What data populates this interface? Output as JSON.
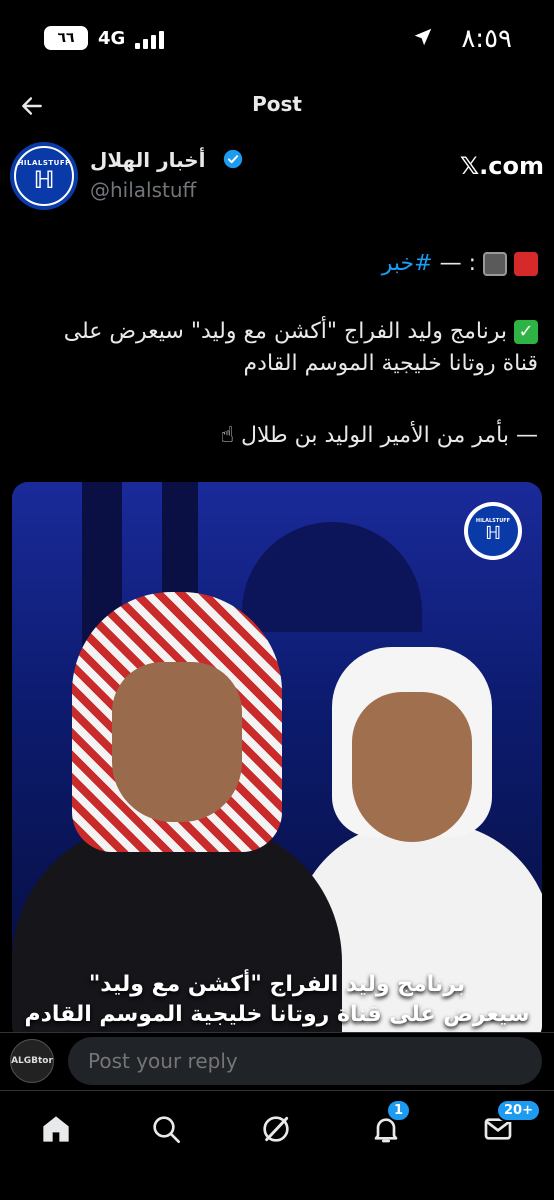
{
  "status_bar": {
    "time": "٨:٥٩",
    "battery": "٦٦",
    "network": "4G"
  },
  "header": {
    "title": "Post"
  },
  "author": {
    "name": "أخبار الهلال",
    "handle": "@hilalstuff",
    "avatar_text": "HILALSTUFF",
    "source": "𝕏.com"
  },
  "tweet": {
    "line1_hashtag": "#خبر",
    "line1_rest": ": — ",
    "line2": "برنامج وليد الفراج \"أكشن مع وليد\" سيعرض على قناة روتانا خليجية الموسم القادم",
    "line3": "— بأمر من الأمير الوليد بن طلال"
  },
  "media": {
    "logo_text": "HILALSTUFF",
    "caption_line1": "برنامج وليد الفراج \"أكشن مع وليد\"",
    "caption_line2": "سيعرض على قناة روتانا خليجية الموسم القادم"
  },
  "reply": {
    "placeholder": "Post your reply",
    "avatar_text": "ALGBtor"
  },
  "nav": {
    "notifications_badge": "1",
    "messages_badge": "20+"
  },
  "colors": {
    "background": "#000000",
    "accent": "#1d9bf0",
    "text_primary": "#e7e9ea",
    "text_secondary": "#71767b"
  }
}
